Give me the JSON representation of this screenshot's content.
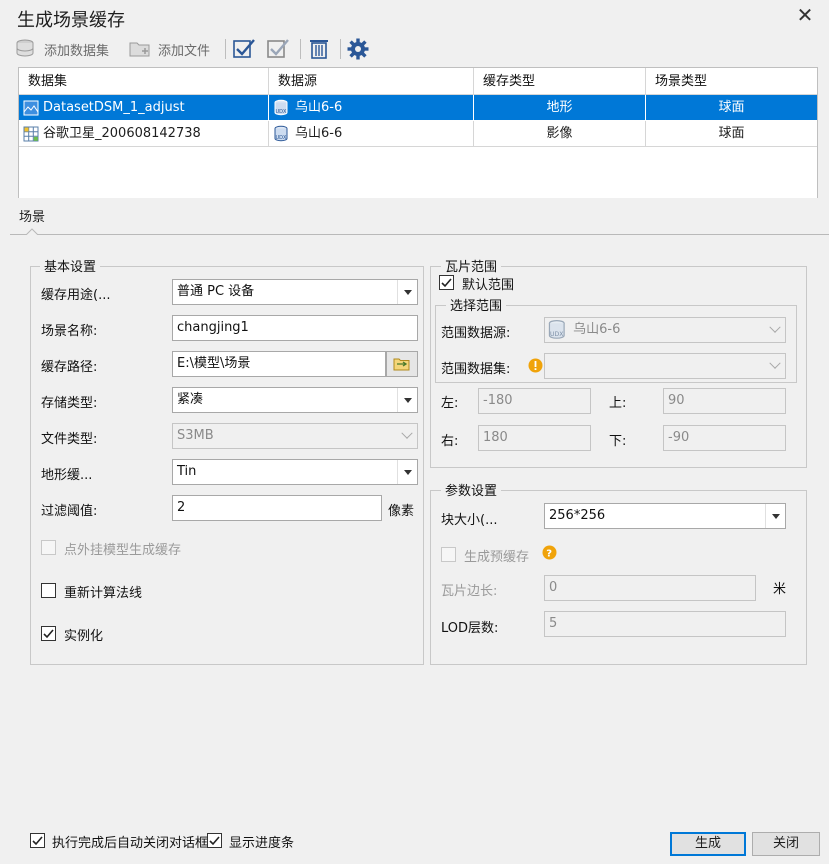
{
  "window": {
    "title": "生成场景缓存"
  },
  "toolbar": {
    "add_dataset": "添加数据集",
    "add_file": "添加文件"
  },
  "table": {
    "headers": [
      "数据集",
      "数据源",
      "缓存类型",
      "场景类型"
    ],
    "rows": [
      {
        "dataset": "DatasetDSM_1_adjust",
        "datasource": "乌山6-6",
        "cache_type": "地形",
        "scene_type": "球面",
        "selected": true
      },
      {
        "dataset": "谷歌卫星_200608142738",
        "datasource": "乌山6-6",
        "cache_type": "影像",
        "scene_type": "球面",
        "selected": false
      }
    ]
  },
  "tab": {
    "label": "场景"
  },
  "basic": {
    "title": "基本设置",
    "cache_use_label": "缓存用途(...",
    "cache_use_value": "普通 PC 设备",
    "scene_name_label": "场景名称:",
    "scene_name_value": "changjing1",
    "cache_path_label": "缓存路径:",
    "cache_path_value": "E:\\模型\\场景",
    "storage_type_label": "存储类型:",
    "storage_type_value": "紧凑",
    "file_type_label": "文件类型:",
    "file_type_value": "S3MB",
    "terrain_label": "地形缓...",
    "terrain_value": "Tin",
    "filter_label": "过滤阈值:",
    "filter_value": "2",
    "filter_unit": "像素",
    "point_model_label": "点外挂模型生成缓存",
    "recalc_normals_label": "重新计算法线",
    "instancing_label": "实例化"
  },
  "tile_range": {
    "title": "瓦片范围",
    "default_range_label": "默认范围",
    "select_title": "选择范围",
    "range_ds_label": "范围数据源:",
    "range_ds_value": "乌山6-6",
    "range_dataset_label": "范围数据集:",
    "left_label": "左:",
    "left_value": "-180",
    "top_label": "上:",
    "top_value": "90",
    "right_label": "右:",
    "right_value": "180",
    "bottom_label": "下:",
    "bottom_value": "-90"
  },
  "params": {
    "title": "参数设置",
    "block_size_label": "块大小(...",
    "block_size_value": "256*256",
    "pre_cache_label": "生成预缓存",
    "tile_edge_label": "瓦片边长:",
    "tile_edge_value": "0",
    "tile_edge_unit": "米",
    "lod_label": "LOD层数:",
    "lod_value": "5"
  },
  "footer": {
    "auto_close_label": "执行完成后自动关闭对话框",
    "show_progress_label": "显示进度条",
    "generate_label": "生成",
    "close_label": "关闭"
  },
  "colors": {
    "accent": "#0078d7",
    "selection": "#0078d7",
    "icon_blue": "#2b5797",
    "warn": "#f0a30a"
  }
}
